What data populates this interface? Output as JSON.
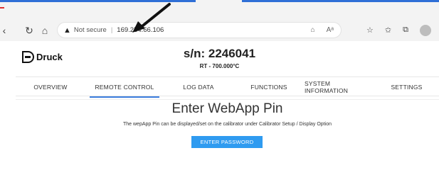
{
  "browser": {
    "address": {
      "security_label": "Not secure",
      "url": "169.254.66.106"
    },
    "icons": [
      "back-icon",
      "refresh-icon",
      "home-icon",
      "warning-icon",
      "read-aloud-icon",
      "favorites-icon",
      "collections-icon",
      "profile-icon"
    ]
  },
  "header": {
    "brand": "Druck",
    "serial": "s/n: 2246041",
    "temperature": "RT - 700.000°C"
  },
  "tabs": [
    {
      "label": "OVERVIEW"
    },
    {
      "label": "REMOTE CONTROL",
      "active": true
    },
    {
      "label": "LOG DATA"
    },
    {
      "label": "FUNCTIONS"
    },
    {
      "label": "SYSTEM INFORMATION"
    },
    {
      "label": "SETTINGS"
    }
  ],
  "main": {
    "title": "Enter WebApp Pin",
    "description": "The wepApp Pin can be displayed/set on the calibrator under Calibrator Setup / Display Option",
    "button_label": "ENTER PASSWORD"
  },
  "colors": {
    "accent": "#3b7ddd",
    "button": "#2f9bf0",
    "tab_indicator": "#2f6fd6"
  }
}
